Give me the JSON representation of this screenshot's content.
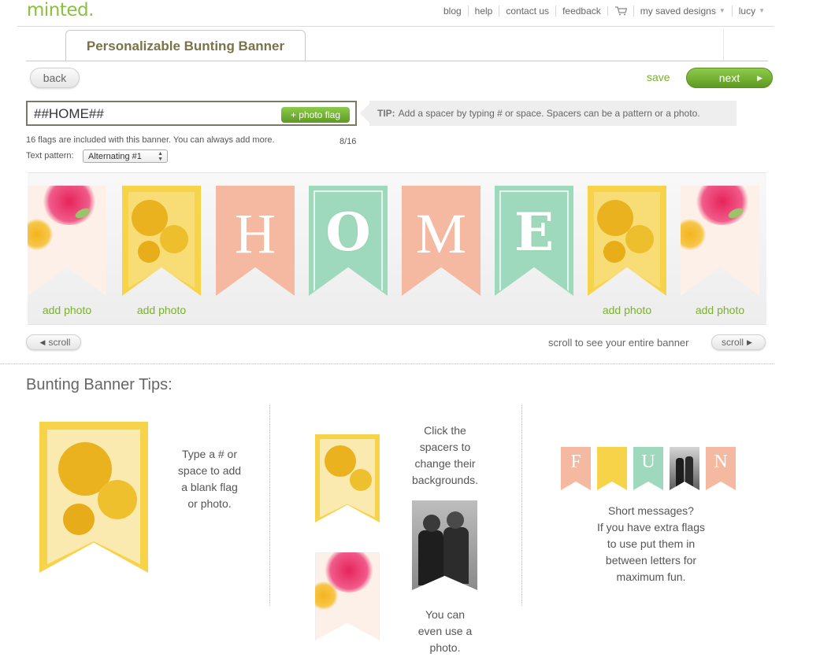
{
  "header": {
    "logo": "minted.",
    "nav": [
      {
        "label": "blog",
        "caret": false
      },
      {
        "label": "help",
        "caret": false
      },
      {
        "label": "contact us",
        "caret": false
      },
      {
        "label": "feedback",
        "caret": false
      },
      {
        "label": "my saved designs",
        "caret": true
      },
      {
        "label": "lucy",
        "caret": true
      }
    ]
  },
  "tab": {
    "title": "Personalizable Bunting Banner"
  },
  "toolbar": {
    "back_label": "back",
    "save_label": "save",
    "next_label": "next"
  },
  "editor": {
    "input_value": "##HOME##",
    "photo_flag_label": "+ photo flag",
    "tip_label": "TIP:",
    "tip_text": "Add a spacer by typing # or space. Spacers can be a pattern or a photo.",
    "info": "16 flags are included with this banner. You can always add more.",
    "count": "8/16",
    "pattern_label": "Text pattern:",
    "pattern_value": "Alternating #1"
  },
  "flags": [
    {
      "type": "floral-cream",
      "letter": "",
      "action": "add photo"
    },
    {
      "type": "yellow",
      "letter": "",
      "action": "add photo"
    },
    {
      "type": "salmon",
      "letter": "H",
      "action": ""
    },
    {
      "type": "mint",
      "letter": "O",
      "action": ""
    },
    {
      "type": "salmon",
      "letter": "M",
      "action": ""
    },
    {
      "type": "mint",
      "letter": "E",
      "action": ""
    },
    {
      "type": "yellow",
      "letter": "",
      "action": "add photo"
    },
    {
      "type": "floral-cream",
      "letter": "",
      "action": "add photo"
    }
  ],
  "scroll": {
    "left_label": "scroll",
    "right_label": "scroll",
    "hint": "scroll to see your entire banner"
  },
  "tips": {
    "title": "Bunting Banner Tips:",
    "tip1": [
      "Type a # or",
      "space to add",
      "a blank flag",
      "or photo."
    ],
    "tip2a": [
      "Click the",
      "spacers to",
      "change their",
      "backgrounds."
    ],
    "tip2b": [
      "You can",
      "even use a",
      "photo."
    ],
    "tip3": [
      "Short messages?",
      "If you have extra flags",
      "to use put them in",
      "between letters for",
      "maximum fun."
    ],
    "mini_letters": [
      "F",
      "",
      "U",
      "",
      "N"
    ]
  },
  "colors": {
    "accent_green": "#7ab12f",
    "salmon": "#f4b9a0",
    "mint": "#9fd9bd",
    "yellow": "#f7d34a"
  }
}
